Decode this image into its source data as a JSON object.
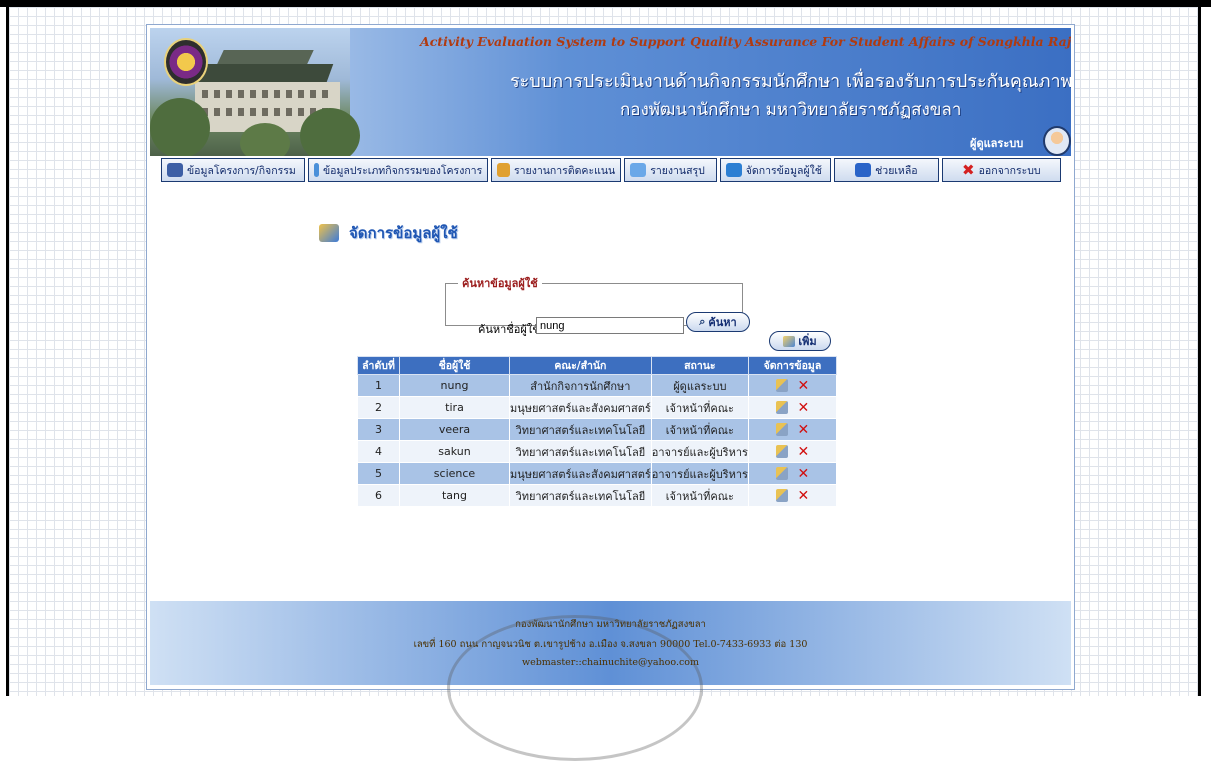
{
  "header": {
    "title_en": "Activity Evaluation System to Support Quality Assurance For Student Affairs of Songkhla Rajabhat University",
    "title_th_line1": "ระบบการประเมินงานด้านกิจกรรมนักศึกษา เพื่อรองรับการประกันคุณภาพ",
    "title_th_line2": "กองพัฒนานักศึกษา มหาวิทยาลัยราชภัฏสงขลา",
    "role": "ผู้ดูแลระบบ"
  },
  "menu": [
    {
      "label": "ข้อมูลโครงการ/กิจกรรม",
      "icon": "computer-icon",
      "color": "#3d5fa5"
    },
    {
      "label": "ข้อมูลประเภทกิจกรรมของโครงการ",
      "icon": "document-icon",
      "color": "#4a90d9"
    },
    {
      "label": "รายงานการติดคะแนน",
      "icon": "report-icon",
      "color": "#e0a030"
    },
    {
      "label": "รายงานสรุป",
      "icon": "chart-icon",
      "color": "#6aa8e8"
    },
    {
      "label": "จัดการข้อมูลผู้ใช้",
      "icon": "users-icon",
      "color": "#2c7fd3"
    },
    {
      "label": "ช่วยเหลือ",
      "icon": "help-icon",
      "color": "#2a64c8"
    },
    {
      "label": "ออกจากระบบ",
      "icon": "exit-icon",
      "color": "#d42020"
    }
  ],
  "page_title": "จัดการข้อมูลผู้ใช้",
  "search": {
    "legend": "ค้นหาข้อมูลผู้ใช้",
    "label": "ค้นหาชื่อผู้ใช้",
    "value": "nung",
    "button": "ค้นหา"
  },
  "add_button": "เพิ่ม",
  "table": {
    "headers": [
      "ลำดับที่",
      "ชื่อผู้ใช้",
      "คณะ/สำนัก",
      "สถานะ",
      "จัดการข้อมูล"
    ],
    "rows": [
      {
        "no": "1",
        "user": "nung",
        "faculty": "สำนักกิจการนักศึกษา",
        "status": "ผู้ดูแลระบบ"
      },
      {
        "no": "2",
        "user": "tira",
        "faculty": "มนุษยศาสตร์และสังคมศาสตร์",
        "status": "เจ้าหน้าที่คณะ"
      },
      {
        "no": "3",
        "user": "veera",
        "faculty": "วิทยาศาสตร์และเทคโนโลยี",
        "status": "เจ้าหน้าที่คณะ"
      },
      {
        "no": "4",
        "user": "sakun",
        "faculty": "วิทยาศาสตร์และเทคโนโลยี",
        "status": "อาจารย์และผู้บริหาร"
      },
      {
        "no": "5",
        "user": "science",
        "faculty": "มนุษยศาสตร์และสังคมศาสตร์",
        "status": "อาจารย์และผู้บริหาร"
      },
      {
        "no": "6",
        "user": "tang",
        "faculty": "วิทยาศาสตร์และเทคโนโลยี",
        "status": "เจ้าหน้าที่คณะ"
      }
    ],
    "delete_glyph": "✕"
  },
  "footer": {
    "line1": "กองพัฒนานักศึกษา มหาวิทยาลัยราชภัฏสงขลา",
    "line2": "เลขที่ 160 ถนน กาญจนวนิช ต.เขารูปช้าง อ.เมือง จ.สงขลา 90000 Tel.0-7433-6933 ต่อ 130",
    "line3": "webmaster::chainuchite@yahoo.com"
  }
}
